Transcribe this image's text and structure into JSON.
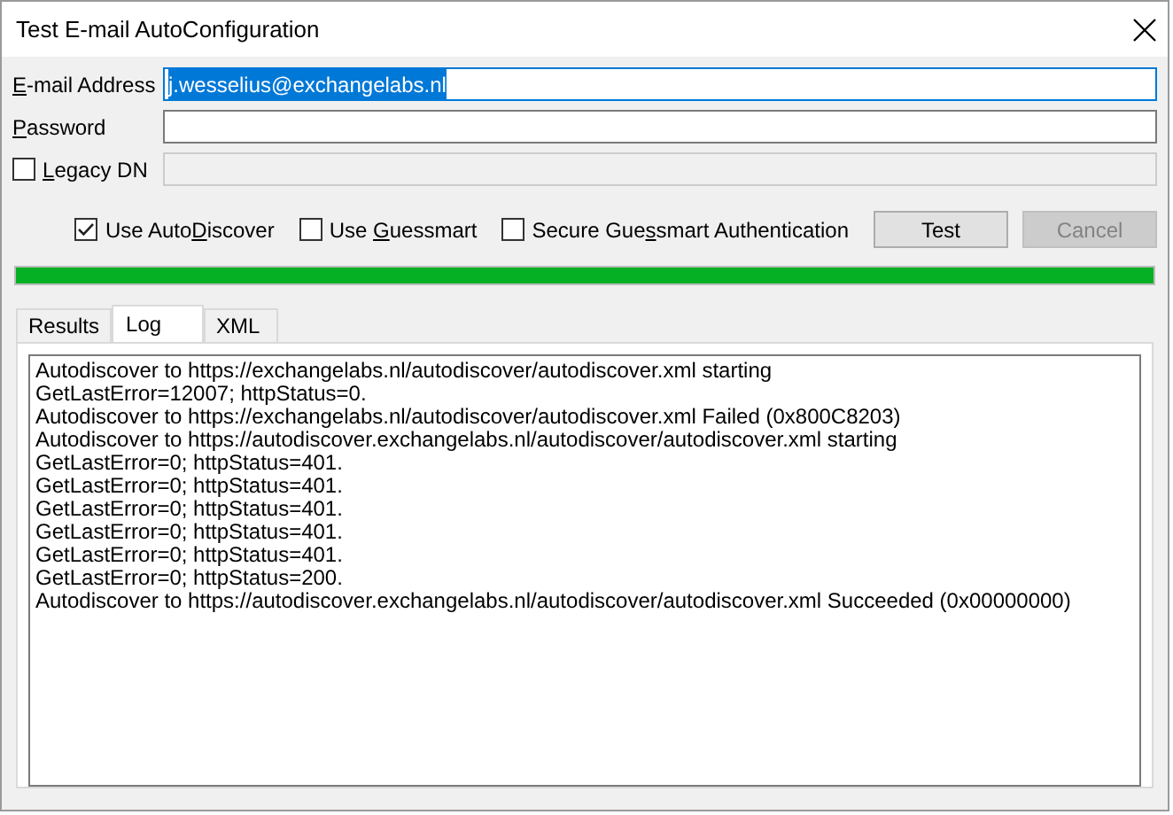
{
  "window": {
    "title": "Test E-mail AutoConfiguration"
  },
  "fields": [
    {
      "label": {
        "key": "E",
        "after": "-mail Address"
      },
      "value": "j.wesselius@exchangelabs.nl",
      "selected": true,
      "disabled": false,
      "kind": "text"
    },
    {
      "label": {
        "key": "P",
        "after": "assword"
      },
      "selected": false,
      "disabled": false,
      "kind": "text"
    },
    {
      "label": {
        "key": "L",
        "after": "egacy DN"
      },
      "selected": false,
      "disabled": true,
      "kind": "checkbox",
      "checked": false
    }
  ],
  "options": [
    {
      "label": {
        "before": "Use Auto",
        "key": "D",
        "after": "iscover"
      },
      "checked": true
    },
    {
      "label": {
        "before": "Use ",
        "key": "G",
        "after": "uessmart"
      },
      "checked": false
    },
    {
      "label": {
        "before": "Secure Gue",
        "key": "s",
        "after": "smart Authentication"
      },
      "checked": false
    }
  ],
  "buttons": [
    {
      "label": "Test",
      "disabled": false
    },
    {
      "label": "Cancel",
      "disabled": true
    }
  ],
  "progress": {
    "level": 1
  },
  "tabs": [
    {
      "label": "Results",
      "selected": false
    },
    {
      "label": "Log",
      "selected": true
    },
    {
      "label": "XML",
      "selected": false
    }
  ],
  "log": [
    "Autodiscover to https://exchangelabs.nl/autodiscover/autodiscover.xml starting",
    "GetLastError=12007; httpStatus=0.",
    "Autodiscover to https://exchangelabs.nl/autodiscover/autodiscover.xml Failed (0x800C8203)",
    "Autodiscover to https://autodiscover.exchangelabs.nl/autodiscover/autodiscover.xml starting",
    "GetLastError=0; httpStatus=401.",
    "GetLastError=0; httpStatus=401.",
    "GetLastError=0; httpStatus=401.",
    "GetLastError=0; httpStatus=401.",
    "GetLastError=0; httpStatus=401.",
    "GetLastError=0; httpStatus=200.",
    "Autodiscover to https://autodiscover.exchangelabs.nl/autodiscover/autodiscover.xml Succeeded (0x00000000)"
  ]
}
